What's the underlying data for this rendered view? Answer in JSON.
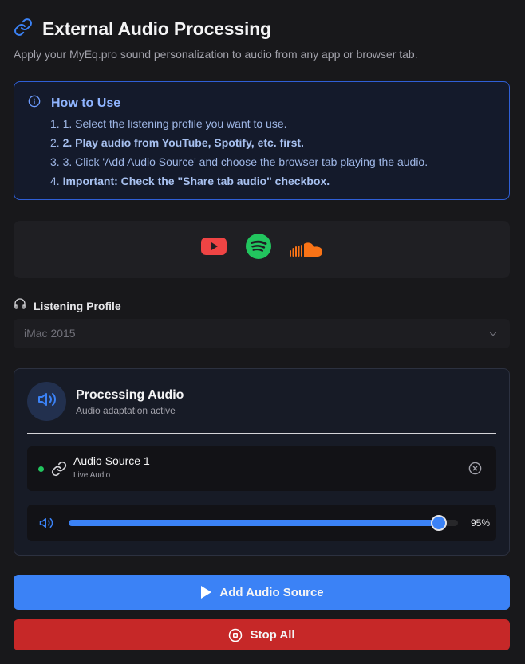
{
  "header": {
    "title": "External Audio Processing",
    "subtitle": "Apply your MyEq.pro sound personalization to audio from any app or browser tab."
  },
  "how_to": {
    "title": "How to Use",
    "steps": [
      "1. 1. Select the listening profile you want to use.",
      "2. 2. Play audio from YouTube, Spotify, etc. first.",
      "3. 3. Click 'Add Audio Source' and choose the browser tab playing the audio.",
      "4. Important: Check the \"Share tab audio\" checkbox."
    ],
    "step_parts": [
      {
        "num": "1.",
        "text": "1. Select the listening profile you want to use."
      },
      {
        "num": "2.",
        "text": "2. Play audio from YouTube, Spotify, etc. first."
      },
      {
        "num": "3.",
        "text": "3. Click 'Add Audio Source' and choose the browser tab playing the audio."
      },
      {
        "num": "4.",
        "text": "Important: Check the \"Share tab audio\" checkbox."
      }
    ]
  },
  "logos": [
    "youtube-logo",
    "spotify-logo",
    "soundcloud-logo"
  ],
  "profile": {
    "label": "Listening Profile",
    "selected": "iMac 2015"
  },
  "processing": {
    "title": "Processing Audio",
    "subtitle": "Audio adaptation active",
    "source": {
      "name": "Audio Source 1",
      "type": "Live Audio",
      "status_color": "#22c55e"
    },
    "volume": {
      "value": 95,
      "label": "95%"
    }
  },
  "buttons": {
    "add_label": "Add Audio Source",
    "stop_label": "Stop All"
  },
  "colors": {
    "accent": "#3b82f6",
    "danger": "#c62828",
    "info_border": "#2f5fd6"
  }
}
